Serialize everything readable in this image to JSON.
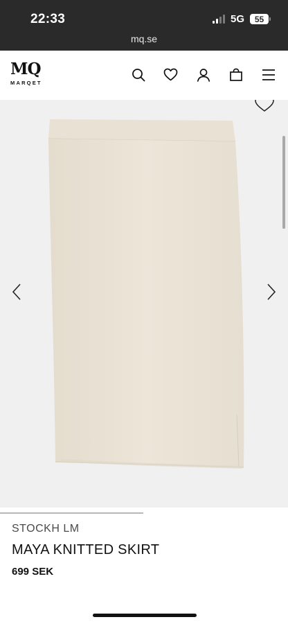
{
  "status_bar": {
    "time": "22:33",
    "network": "5G",
    "battery": "55"
  },
  "browser": {
    "url": "mq.se"
  },
  "header": {
    "logo_mark": "MQ",
    "logo_word": "MARQET",
    "icons": [
      "search-icon",
      "heart-icon",
      "user-icon",
      "bag-icon",
      "menu-icon"
    ]
  },
  "product": {
    "brand": "STOCKH LM",
    "name": "MAYA KNITTED SKIRT",
    "price": "699 SEK",
    "image_background": "#f0f0f0",
    "fabric_color": "#ebe4d7"
  }
}
